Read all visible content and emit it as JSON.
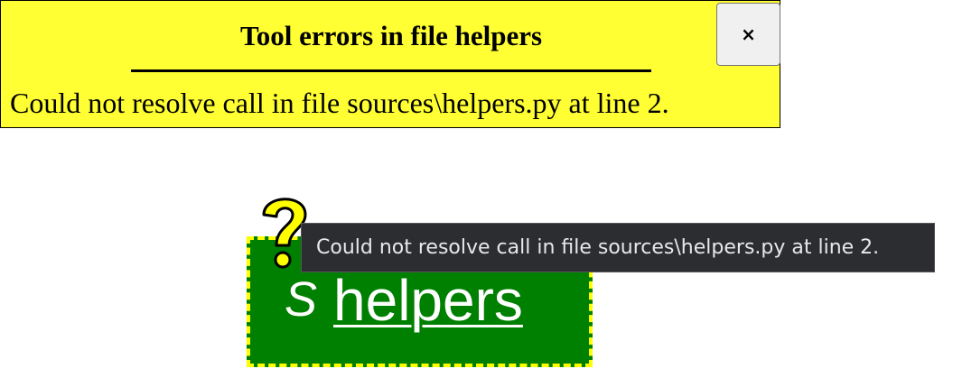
{
  "banner": {
    "title": "Tool errors in file helpers",
    "message": "Could not resolve call in file sources\\helpers.py at line 2.",
    "close_label": "×",
    "background": "#ffff33"
  },
  "node": {
    "kind": "S",
    "name": "helpers",
    "background": "#008000",
    "border_color": "#ffff00",
    "icon": "question-mark-icon"
  },
  "tooltip": {
    "text": "Could not resolve call in file sources\\helpers.py at line 2."
  }
}
